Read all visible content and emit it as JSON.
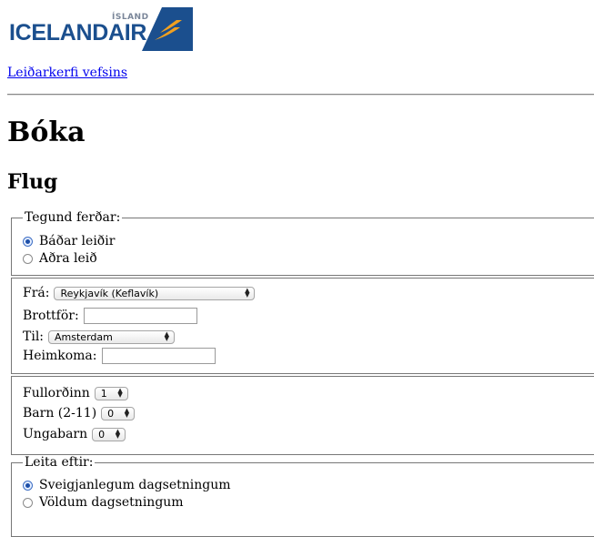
{
  "logo": {
    "country": "ÍSLAND",
    "brand": "ICELANDAIR"
  },
  "nav_link": "Leiðarkerfi vefsins",
  "page_title": "Bóka",
  "section_title": "Flug",
  "trip_type": {
    "legend": "Tegund ferðar:",
    "options": [
      {
        "label": "Báðar leiðir",
        "selected": true
      },
      {
        "label": "Aðra leið",
        "selected": false
      }
    ]
  },
  "route": {
    "from_label": "Frá:",
    "from_value": "Reykjavík (Keflavík)",
    "departure_label": "Brottför:",
    "departure_value": "",
    "to_label": "Til:",
    "to_value": "Amsterdam",
    "return_label": "Heimkoma:",
    "return_value": ""
  },
  "passengers": {
    "adults_label": "Fullorðinn",
    "adults_value": "1",
    "children_label": "Barn (2-11)",
    "children_value": "0",
    "infants_label": "Ungabarn",
    "infants_value": "0"
  },
  "search_by": {
    "legend": "Leita eftir:",
    "options": [
      {
        "label": "Sveigjanlegum dagsetningum",
        "selected": true
      },
      {
        "label": "Völdum dagsetningum",
        "selected": false
      }
    ]
  },
  "colors": {
    "brand_blue": "#1b4f8e",
    "accent_orange": "#f0a020",
    "link": "#0000ee"
  }
}
